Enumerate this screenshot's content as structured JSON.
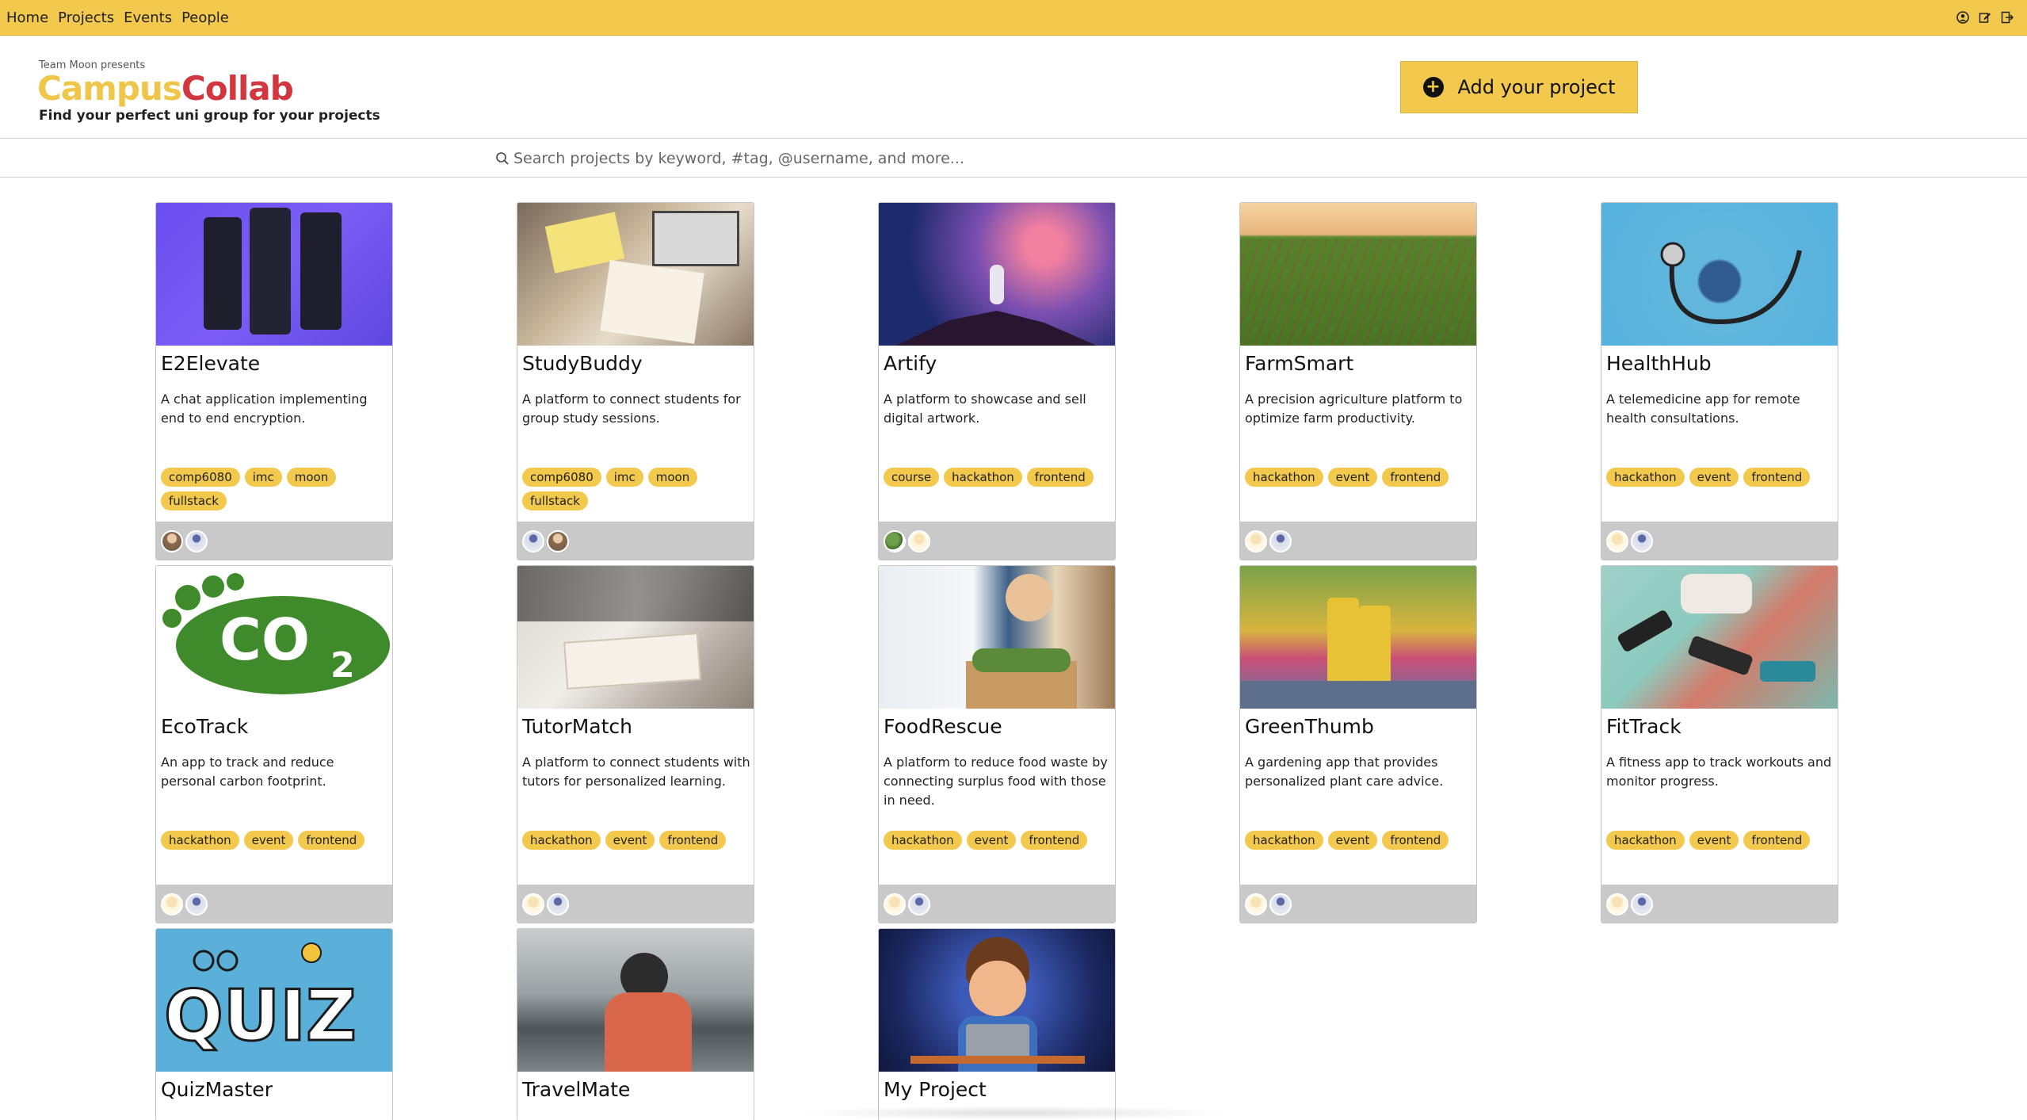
{
  "nav": {
    "links": [
      "Home",
      "Projects",
      "Events",
      "People"
    ],
    "icons": [
      "user-circle-icon",
      "edit-icon",
      "logout-icon"
    ]
  },
  "header": {
    "presents": "Team Moon presents",
    "logo_part1": "Campus",
    "logo_part2": "Collab",
    "tagline": "Find your perfect uni group for your projects",
    "add_button": "Add your project"
  },
  "search": {
    "placeholder": "Search projects by keyword, #tag, @username, and more..."
  },
  "colors": {
    "accent": "#f2c94c",
    "logo_yellow": "#efc64a",
    "logo_red": "#d2363f",
    "footer_gray": "#c9c9c9"
  },
  "projects": [
    {
      "title": "E2Elevate",
      "description": "A chat application implementing end to end encryption.",
      "tags": [
        "comp6080",
        "imc",
        "moon",
        "fullstack"
      ],
      "image": "chat-app-screens",
      "avatars": [
        "av-a",
        "av-b"
      ]
    },
    {
      "title": "StudyBuddy",
      "description": "A platform to connect students for group study sessions.",
      "tags": [
        "comp6080",
        "imc",
        "moon",
        "fullstack"
      ],
      "image": "study-desk",
      "avatars": [
        "av-b",
        "av-a"
      ]
    },
    {
      "title": "Artify",
      "description": "A platform to showcase and sell digital artwork.",
      "tags": [
        "course",
        "hackathon",
        "frontend"
      ],
      "image": "astronaut-space",
      "avatars": [
        "av-d",
        "av-c"
      ]
    },
    {
      "title": "FarmSmart",
      "description": "A precision agriculture platform to optimize farm productivity.",
      "tags": [
        "hackathon",
        "event",
        "frontend"
      ],
      "image": "crop-field",
      "avatars": [
        "av-c",
        "av-b"
      ]
    },
    {
      "title": "HealthHub",
      "description": "A telemedicine app for remote health consultations.",
      "tags": [
        "hackathon",
        "event",
        "frontend"
      ],
      "image": "stethoscope-globe",
      "avatars": [
        "av-c",
        "av-b"
      ]
    },
    {
      "title": "EcoTrack",
      "description": "An app to track and reduce personal carbon footprint.",
      "tags": [
        "hackathon",
        "event",
        "frontend"
      ],
      "image": "co2-footprint",
      "avatars": [
        "av-c",
        "av-b"
      ]
    },
    {
      "title": "TutorMatch",
      "description": "A platform to connect students with tutors for personalized learning.",
      "tags": [
        "hackathon",
        "event",
        "frontend"
      ],
      "image": "tutoring-book",
      "avatars": [
        "av-c",
        "av-b"
      ]
    },
    {
      "title": "FoodRescue",
      "description": "A platform to reduce food waste by connecting surplus food with those in need.",
      "tags": [
        "hackathon",
        "event",
        "frontend"
      ],
      "image": "volunteer-food-box",
      "avatars": [
        "av-c",
        "av-b"
      ]
    },
    {
      "title": "GreenThumb",
      "description": "A gardening app that provides personalized plant care advice.",
      "tags": [
        "hackathon",
        "event",
        "frontend"
      ],
      "image": "garden-boots",
      "avatars": [
        "av-c",
        "av-b"
      ]
    },
    {
      "title": "FitTrack",
      "description": "A fitness app to track workouts and monitor progress.",
      "tags": [
        "hackathon",
        "event",
        "frontend"
      ],
      "image": "dumbbells",
      "avatars": [
        "av-c",
        "av-b"
      ]
    },
    {
      "title": "QuizMaster",
      "description": "",
      "tags": [],
      "image": "quiz-banner",
      "avatars": []
    },
    {
      "title": "TravelMate",
      "description": "",
      "tags": [],
      "image": "traveler-lake",
      "avatars": []
    },
    {
      "title": "My Project",
      "description": "",
      "tags": [],
      "image": "cartoon-coder",
      "avatars": []
    }
  ]
}
